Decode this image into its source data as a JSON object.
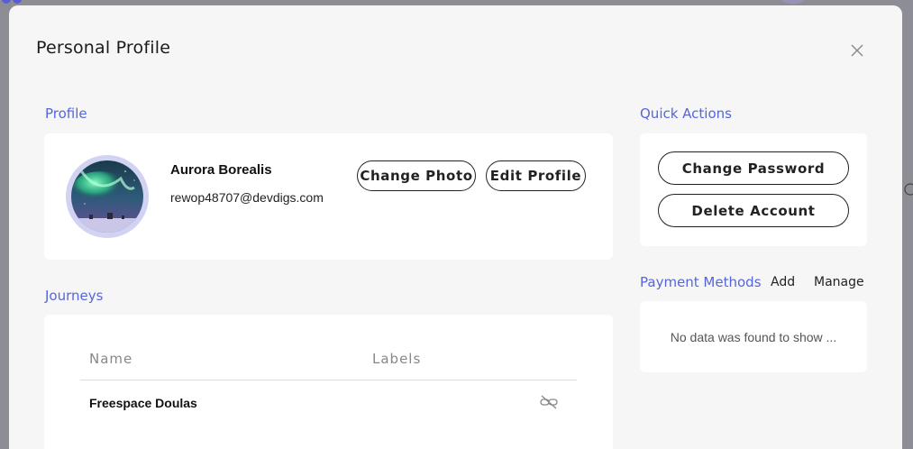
{
  "modal": {
    "title": "Personal Profile",
    "close_icon": "close-icon"
  },
  "profile": {
    "section_label": "Profile",
    "name": "Aurora Borealis",
    "email": "rewop48707@devdigs.com",
    "change_photo_label": "Change Photo",
    "edit_profile_label": "Edit Profile"
  },
  "quick_actions": {
    "section_label": "Quick Actions",
    "change_password_label": "Change Password",
    "delete_account_label": "Delete Account"
  },
  "payment_methods": {
    "section_label": "Payment Methods",
    "add_label": "Add",
    "manage_label": "Manage",
    "empty_message": "No data was found to show ..."
  },
  "journeys": {
    "section_label": "Journeys",
    "columns": [
      "Name",
      "Labels"
    ],
    "rows": [
      {
        "name": "Freespace Doulas",
        "label_icon": "unlink-icon"
      }
    ]
  },
  "colors": {
    "accent": "#5566dd",
    "backdrop": "#8d8d95",
    "modal_bg": "#f6f6f6",
    "card_bg": "#ffffff"
  }
}
